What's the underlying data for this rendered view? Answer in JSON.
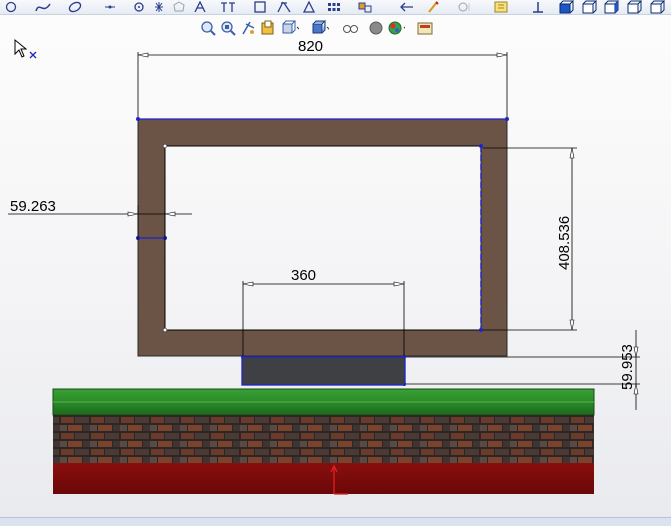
{
  "dimensions": {
    "top_width": "820",
    "left_thickness": "59.263",
    "inner_height": "408.536",
    "base_width": "360",
    "base_height": "59.953"
  },
  "colors": {
    "frame": "#6b5446",
    "base_block": "#3f4044",
    "grass": "#2f8a2a",
    "bricks": "#5a3a2c",
    "ground": "#7a0a0a",
    "sketch_line": "#1e24c8",
    "dimension_line": "#000000"
  },
  "toolbar": {
    "top_icons": [
      "circle-tool-icon",
      "spline-icon",
      "ellipse-icon",
      "point-icon",
      "sketch-fillet-icon",
      "centerline-icon",
      "polygon-icon",
      "text-icon",
      "mirror-icon",
      "trim-icon",
      "offset-icon",
      "linear-pattern-icon",
      "convert-icon",
      "move-icon",
      "relations-icon",
      "rapid-sketch-icon",
      "display-delete-icon",
      "pin-icon",
      "view-front-icon",
      "view-top-icon",
      "view-iso-icon",
      "view-right-icon",
      "view-back-icon"
    ],
    "view_icons": [
      "zoom-to-fit-icon",
      "zoom-area-icon",
      "previous-view-icon",
      "section-view-icon",
      "view-orientation-icon",
      "display-style-icon",
      "hide-show-icon",
      "edit-appearance-icon",
      "apply-scene-icon",
      "view-settings-icon"
    ]
  }
}
